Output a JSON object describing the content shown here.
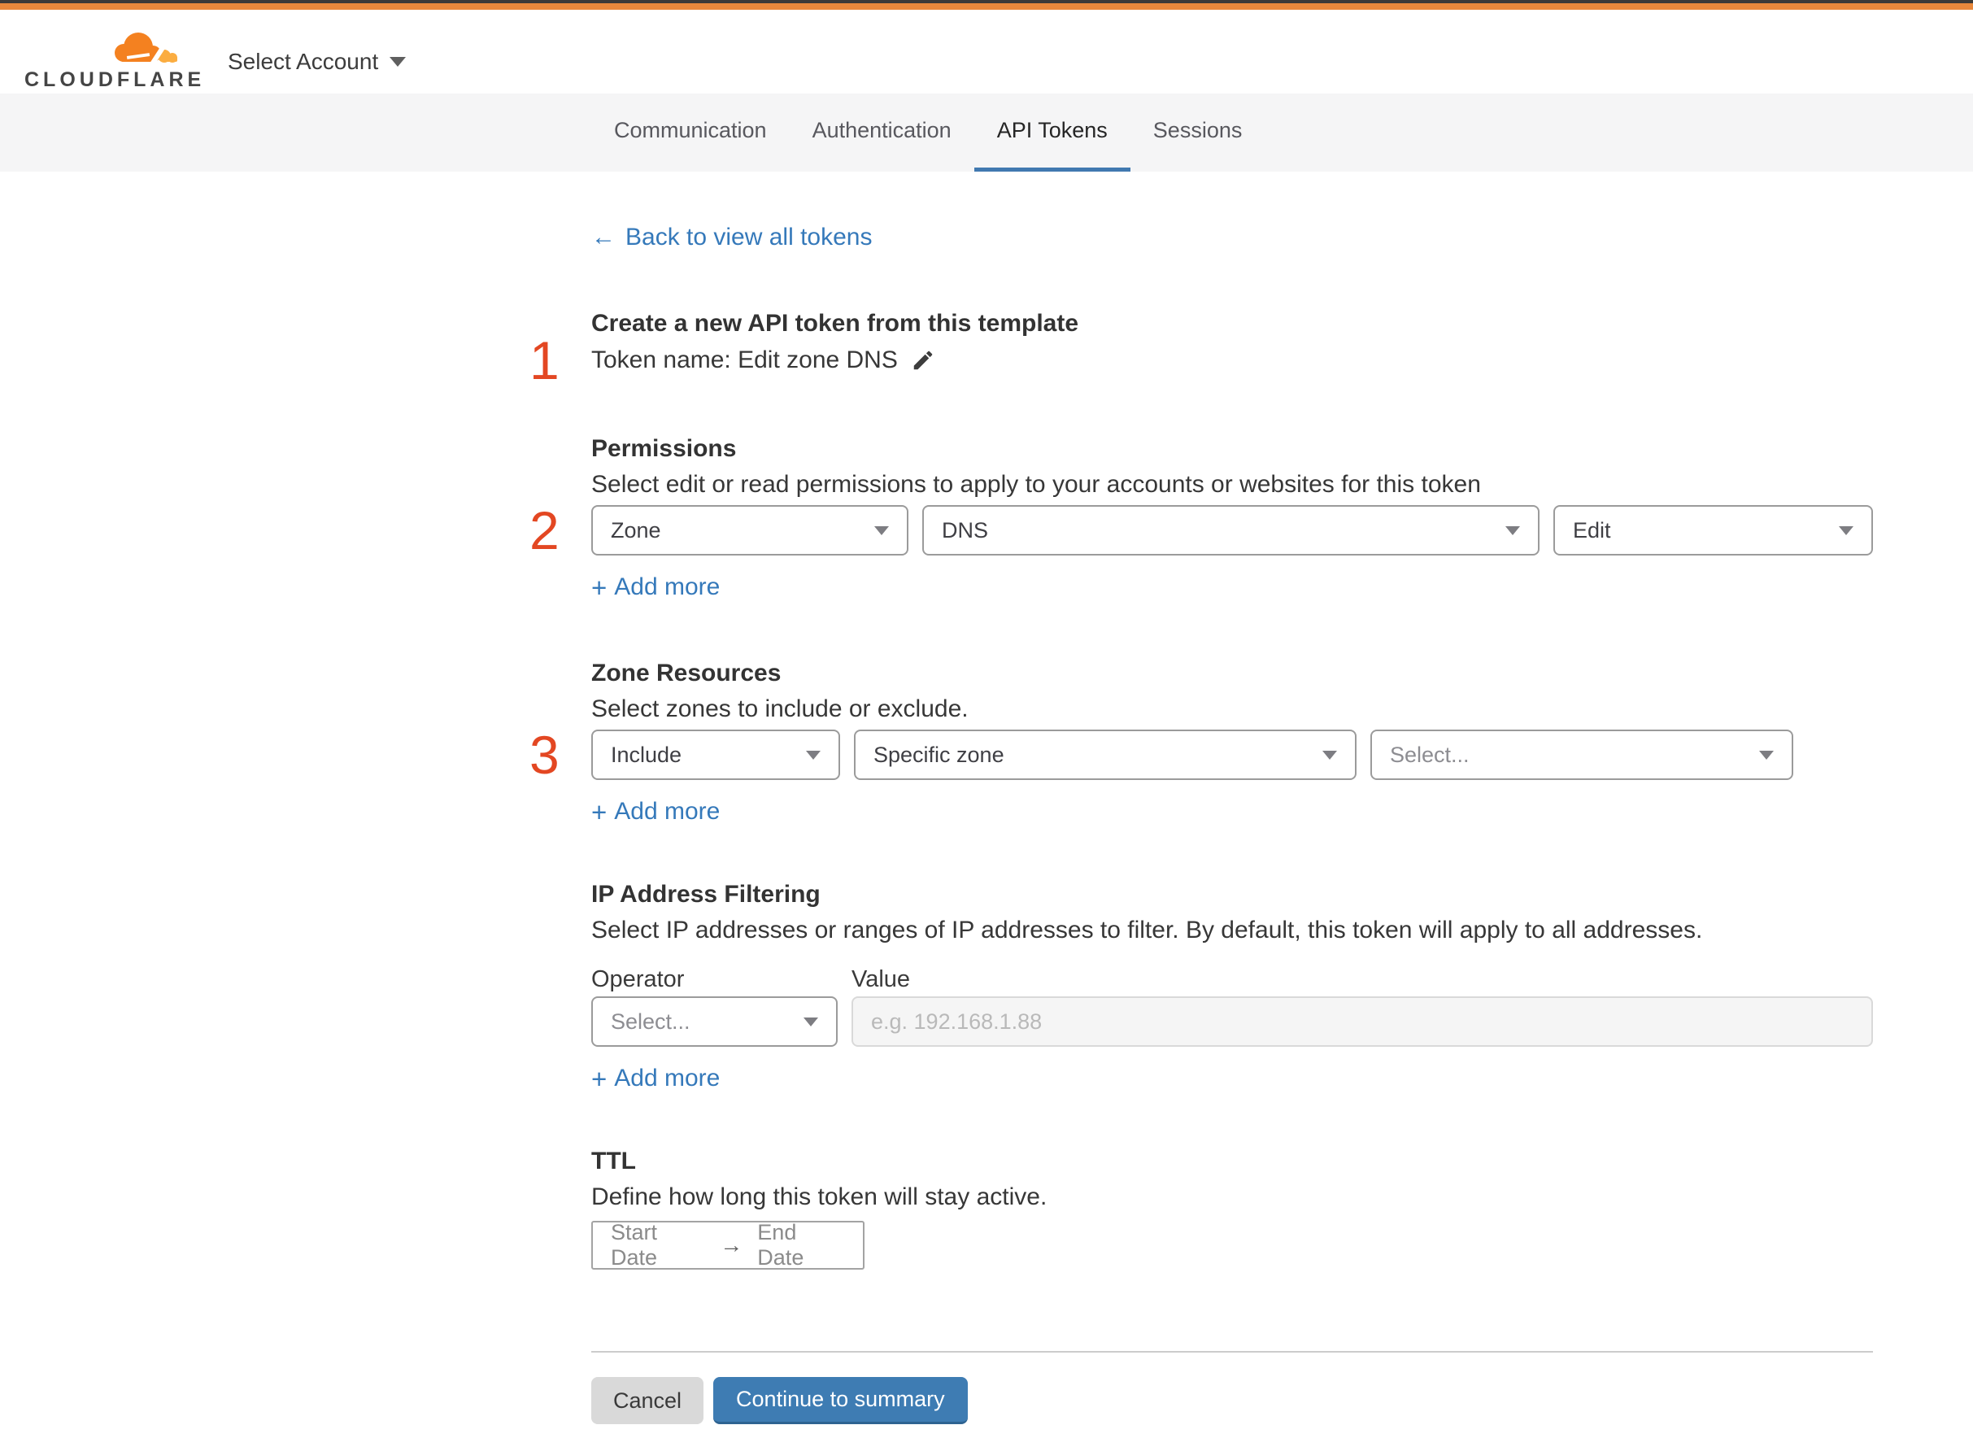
{
  "header": {
    "brand": "CLOUDFLARE",
    "account_selector_label": "Select Account"
  },
  "tabs": {
    "items": [
      {
        "label": "Communication",
        "active": false
      },
      {
        "label": "Authentication",
        "active": false
      },
      {
        "label": "API Tokens",
        "active": true
      },
      {
        "label": "Sessions",
        "active": false
      }
    ]
  },
  "back_link": {
    "arrow": "←",
    "label": "Back to view all tokens"
  },
  "step1": {
    "number": "1",
    "heading": "Create a new API token from this template",
    "token_name": "Token name: Edit zone DNS"
  },
  "step2": {
    "number": "2",
    "heading": "Permissions",
    "description": "Select edit or read permissions to apply to your accounts or websites for this token",
    "select_scope": "Zone",
    "select_service": "DNS",
    "select_access": "Edit",
    "add_more": "Add more"
  },
  "step3": {
    "number": "3",
    "heading": "Zone Resources",
    "description": "Select zones to include or exclude.",
    "select_mode": "Include",
    "select_type": "Specific zone",
    "select_zone_placeholder": "Select...",
    "add_more": "Add more"
  },
  "ip_filtering": {
    "heading": "IP Address Filtering",
    "description": "Select IP addresses or ranges of IP addresses to filter. By default, this token will apply to all addresses.",
    "operator_label": "Operator",
    "value_label": "Value",
    "operator_placeholder": "Select...",
    "value_placeholder": "e.g. 192.168.1.88",
    "add_more": "Add more"
  },
  "ttl": {
    "heading": "TTL",
    "description": "Define how long this token will stay active.",
    "start_label": "Start Date",
    "arrow": "→",
    "end_label": "End Date"
  },
  "footer": {
    "cancel_label": "Cancel",
    "continue_label": "Continue to summary"
  },
  "icons": {
    "plus": "+"
  },
  "colors": {
    "brand_orange": "#f48120",
    "brand_orange_light": "#fbad41",
    "topbar_orange": "#e8883c",
    "accent_blue": "#3e7cb3",
    "link_blue": "#3579ba",
    "step_number_red": "#e34722"
  }
}
